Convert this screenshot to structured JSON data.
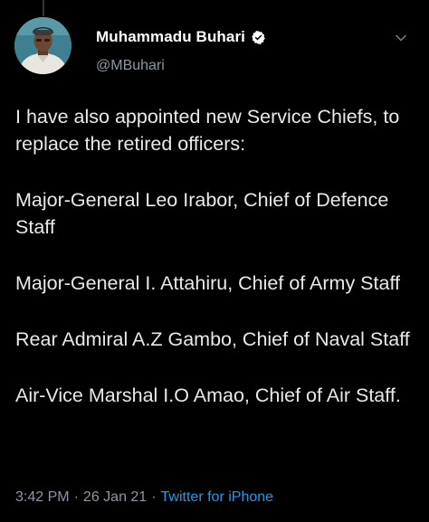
{
  "tweet": {
    "author": {
      "name": "Muhammadu Buhari",
      "handle": "@MBuhari",
      "verified": true
    },
    "paragraphs": [
      "I have also appointed new Service Chiefs, to replace the retired officers:",
      "Major-General Leo Irabor, Chief of Defence Staff",
      "Major-General I. Attahiru, Chief of Army Staff",
      "Rear Admiral A.Z Gambo, Chief of Naval Staff",
      "Air-Vice Marshal I.O Amao, Chief of Air Staff."
    ],
    "time": "3:42 PM",
    "separator": "·",
    "date": "26 Jan 21",
    "source": "Twitter for iPhone"
  },
  "icons": {
    "verified": "verified-badge-icon",
    "menu": "chevron-down-icon",
    "avatar": "profile-photo"
  },
  "colors": {
    "background": "#000000",
    "text": "#e7e9ea",
    "muted": "#8b98a5",
    "link": "#1d9bf0",
    "verified": "#ffffff"
  }
}
